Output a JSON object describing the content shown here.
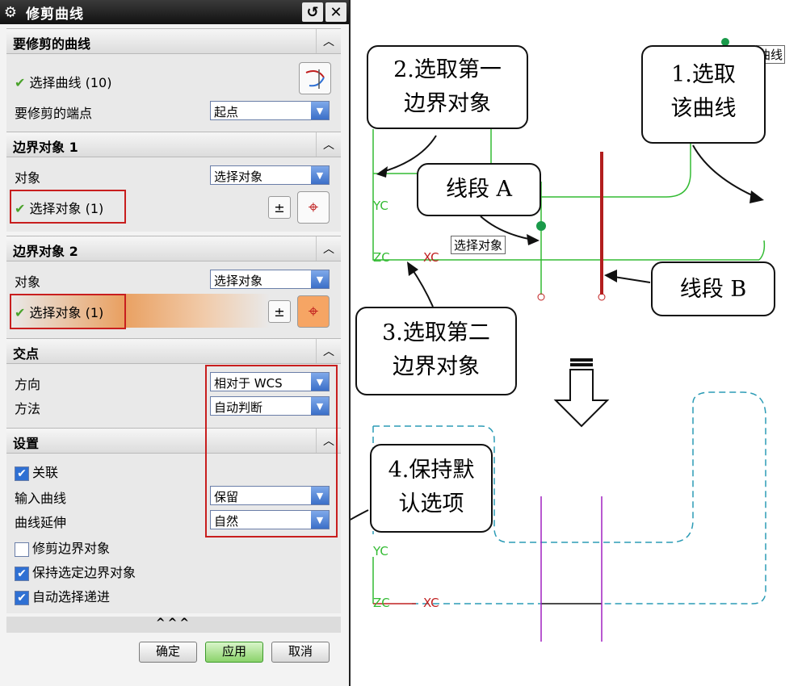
{
  "dialog": {
    "title": "修剪曲线",
    "icons": {
      "title": "gear-icon",
      "reset": "reset-icon",
      "close": "close-icon"
    },
    "sections": {
      "curve_to_trim": {
        "title": "要修剪的曲线",
        "select_label": "选择曲线 (10)",
        "endpoint_label": "要修剪的端点",
        "endpoint_value": "起点"
      },
      "boundary1": {
        "title": "边界对象 1",
        "object_label": "对象",
        "object_value": "选择对象",
        "select_label": "选择对象 (1)"
      },
      "boundary2": {
        "title": "边界对象 2",
        "object_label": "对象",
        "object_value": "选择对象",
        "select_label": "选择对象 (1)"
      },
      "intersection": {
        "title": "交点",
        "direction_label": "方向",
        "direction_value": "相对于 WCS",
        "method_label": "方法",
        "method_value": "自动判断"
      },
      "settings": {
        "title": "设置",
        "associative": "关联",
        "input_curve_label": "输入曲线",
        "input_curve_value": "保留",
        "extension_label": "曲线延伸",
        "extension_value": "自然",
        "trim_boundary": "修剪边界对象",
        "keep_boundary": "保持选定边界对象",
        "auto_advance": "自动选择递进"
      }
    },
    "more": "^^^",
    "buttons": {
      "ok": "确定",
      "apply": "应用",
      "cancel": "取消"
    }
  },
  "canvas": {
    "callouts": {
      "c1_line1": "1.选取",
      "c1_line2": "该曲线",
      "c2_line1": "2.选取第一",
      "c2_line2": "边界对象",
      "c3_line1": "3.选取第二",
      "c3_line2": "边界对象",
      "c4_line1": "4.保持默",
      "c4_line2": "认选项",
      "seg_a": "线段 A",
      "seg_b": "线段 B"
    },
    "tooltip_select": "选择对象",
    "tooltip_curve": "曲线",
    "axes_top": {
      "y": "YC",
      "z": "ZC",
      "x": "XC"
    },
    "axes_bottom": {
      "y": "YC",
      "z": "ZC",
      "x": "XC"
    }
  }
}
